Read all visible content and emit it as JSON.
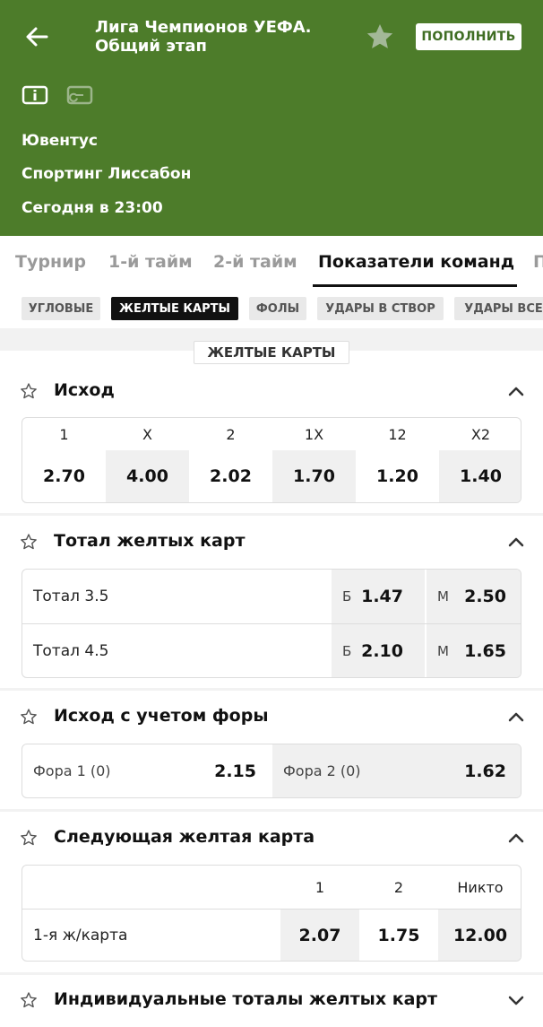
{
  "header": {
    "title": "Лига Чемпионов УЕФА. Общий этап",
    "topup_label": "ПОПОЛНИТЬ",
    "team1": "Ювентус",
    "team2": "Спортинг Лиссабон",
    "time": "Сегодня в 23:00",
    "bg_color": "#4d7c2a"
  },
  "tabs": [
    "Турнир",
    "1-й тайм",
    "2-й тайм",
    "Показатели команд",
    "П"
  ],
  "chips": [
    "УГЛОВЫЕ",
    "ЖЕЛТЫЕ КАРТЫ",
    "ФОЛЫ",
    "УДАРЫ В СТВОР",
    "УДАРЫ ВСЕ"
  ],
  "section_label": "ЖЕЛТЫЕ КАРТЫ",
  "markets": {
    "outcome": {
      "title": "Исход",
      "headers": [
        "1",
        "X",
        "2",
        "1X",
        "12",
        "X2"
      ],
      "odds": [
        "2.70",
        "4.00",
        "2.02",
        "1.70",
        "1.20",
        "1.40"
      ]
    },
    "total": {
      "title": "Тотал желтых карт",
      "rows": [
        {
          "label": "Тотал 3.5",
          "b": "Б",
          "b_odd": "1.47",
          "m": "М",
          "m_odd": "2.50"
        },
        {
          "label": "Тотал 4.5",
          "b": "Б",
          "b_odd": "2.10",
          "m": "М",
          "m_odd": "1.65"
        }
      ]
    },
    "handicap": {
      "title": "Исход с учетом форы",
      "f1_label": "Фора 1 (0)",
      "f1_odd": "2.15",
      "f2_label": "Фора 2 (0)",
      "f2_odd": "1.62"
    },
    "next_card": {
      "title": "Следующая желтая карта",
      "headers": [
        "1",
        "2",
        "Никто"
      ],
      "row_label": "1-я ж/карта",
      "odds": [
        "2.07",
        "1.75",
        "12.00"
      ]
    },
    "individual": {
      "title": "Индивидуальные тоталы желтых карт"
    }
  }
}
